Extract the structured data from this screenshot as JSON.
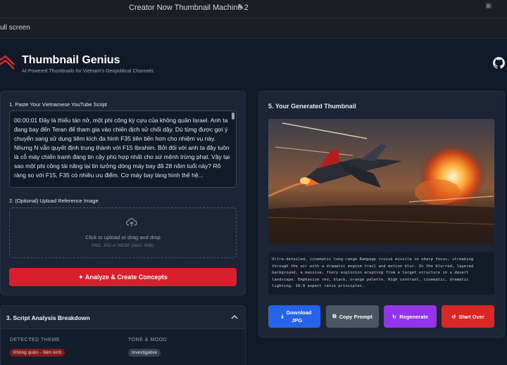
{
  "window": {
    "title": "Creator Now Thumbnail Machine 2",
    "fullscreen_label": "ull screen"
  },
  "header": {
    "brand": "Thumbnail Genius",
    "tagline": "AI-Powered Thumbnails for Vietnam's Geopolitical Channels"
  },
  "script_section": {
    "label": "1. Paste Your Vietnamese YouTube Script",
    "value": "00:00:01 Đây là thiếu tán nở, một phi công kỳ cựu của không quân Israel. Anh ta đang bay đến Teran để tham gia vào chiến dịch sử chối dậy. Dù từng được gợi ý chuyển sang sử dụng tiêm kích đa hình F35 tiên tiến hơn cho nhiệm vụ này. Nhưng N vẫn quyết định trung thành với F15 Ibrahim. Bởi đối với anh ta đây luôn là cỗ máy chiến tranh đáng tin cậy phù hợp nhất cho sứ mệnh trừng phạt. Vậy tại sao một phi công tài năng lại tin tưởng dòng máy bay đã 28 năm tuổi này? Rõ ràng so với F15, F35 có nhiều ưu điểm. Cơ máy bay tàng hình thế hệ..."
  },
  "upload_section": {
    "label": "2. (Optional) Upload Reference Image",
    "cta": "Click to upload or drag and drop",
    "hint": "PNG, JPG or WEBP (MAX. 4MB)"
  },
  "analyze_button": {
    "label": "Analyze & Create Concepts"
  },
  "breakdown": {
    "title": "3. Script Analysis Breakdown",
    "theme_label": "DETECTED THEME",
    "theme_value": "Không quân – tiêm kích",
    "tone_label": "TONE & MOOD",
    "tone_value": "Investigative"
  },
  "result": {
    "title": "5. Your Generated Thumbnail",
    "prompt": "Ultra-detailed, cinematic long-range Rampage cruise missile in sharp focus, streaking through the air with a dramatic engine trail and motion blur. In the blurred, layered background, a massive, fiery explosion erupting from a target structure in a desert landscape. Emphasize red, black, orange palette. High contrast, cinematic, dramatic lighting. 16:9 aspect ratio principles."
  },
  "actions": {
    "download": "Download JPG",
    "copy": "Copy Prompt",
    "regenerate": "Regenerate",
    "start_over": "Start Over"
  },
  "colors": {
    "accent_red": "#d7202b",
    "download_blue": "#2563eb",
    "copy_gray": "#4b5563",
    "regen_purple": "#9333ea",
    "start_red": "#dc2626"
  }
}
